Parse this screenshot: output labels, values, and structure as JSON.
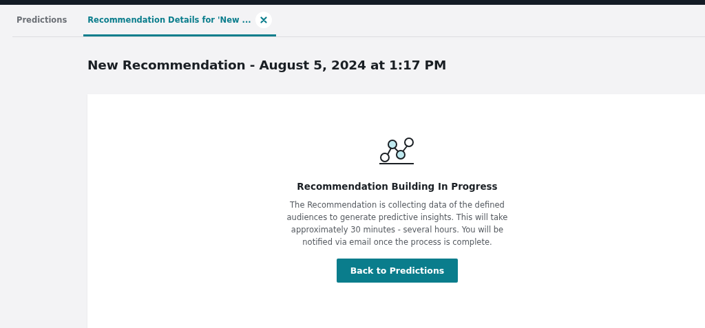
{
  "tabs": [
    {
      "label": "Predictions",
      "selected": false,
      "closable": false
    },
    {
      "label": "Recommendation Details for 'New ...",
      "selected": true,
      "closable": true
    }
  ],
  "page_title": "New Recommendation - August 5, 2024 at 1:17 PM",
  "status": {
    "heading": "Recommendation Building In Progress",
    "message": "The Recommendation is collecting data of the defined audiences to generate predictive insights. This will take approximately 30 minutes - several hours. You will be notified via email once the process is complete.",
    "button": "Back to Predictions"
  }
}
